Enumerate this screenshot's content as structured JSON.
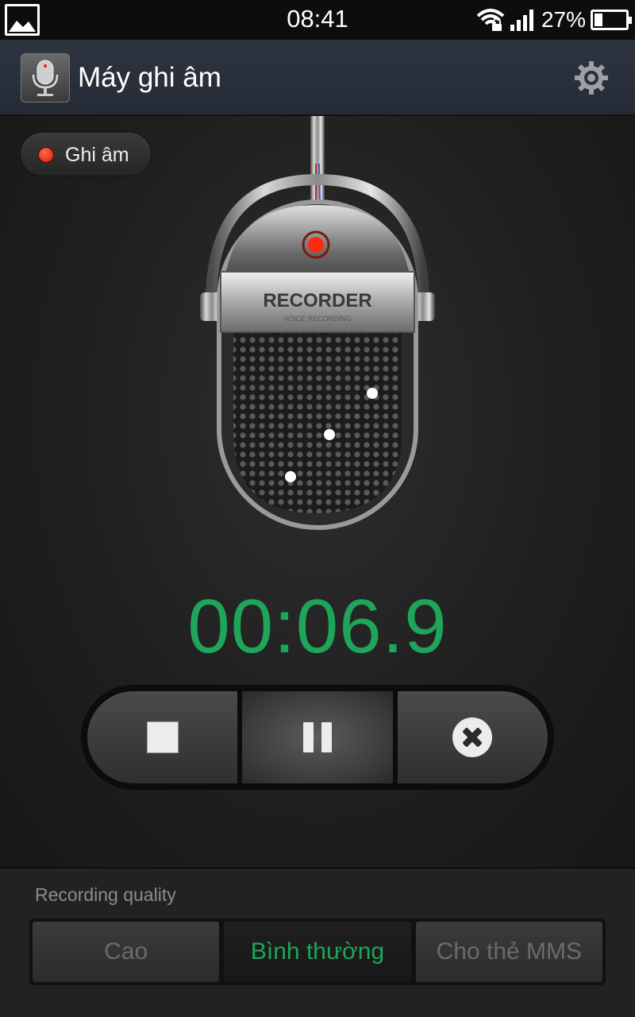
{
  "status_bar": {
    "time": "08:41",
    "battery_percent": "27%",
    "battery_level": 0.27,
    "icons": [
      "gallery-icon",
      "wifi-icon",
      "signal-icon",
      "battery-icon"
    ]
  },
  "action_bar": {
    "title": "Máy ghi âm",
    "app_icon": "microphone-icon",
    "settings_icon": "gear-icon"
  },
  "recording_indicator": {
    "label": "Ghi âm",
    "dot_color": "#e0240f"
  },
  "microphone_art": {
    "brand_text": "RECORDER",
    "sub_text": "VOICE RECORDING"
  },
  "timer": {
    "value": "00:06.9",
    "color": "#1fa55a"
  },
  "controls": [
    {
      "name": "stop",
      "icon": "stop-icon"
    },
    {
      "name": "pause",
      "icon": "pause-icon"
    },
    {
      "name": "cancel",
      "icon": "close-circle-icon"
    }
  ],
  "quality": {
    "label": "Recording quality",
    "options": [
      "Cao",
      "Bình thường",
      "Cho thẻ MMS"
    ],
    "selected": "Bình thường",
    "accent": "#1fa55a"
  }
}
